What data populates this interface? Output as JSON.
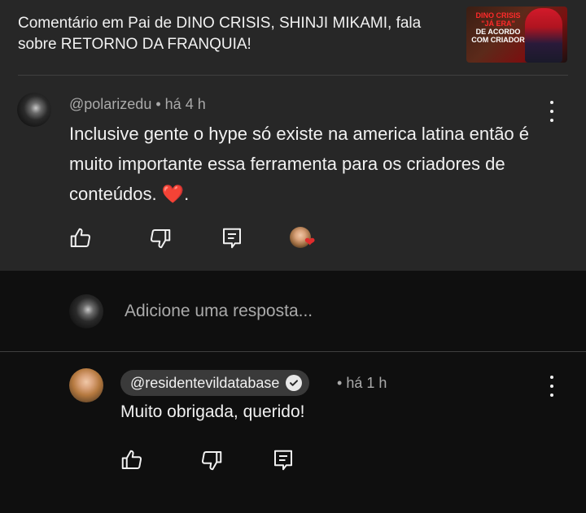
{
  "video": {
    "title": "Comentário em Pai de DINO CRISIS, SHINJI MIKAMI, fala sobre RETORNO DA FRANQUIA!",
    "thumbnail": {
      "line1": "DINO CRISIS",
      "line2": "\"JÁ ERA\"",
      "line3": "DE ACORDO",
      "line4": "COM CRIADOR"
    }
  },
  "comment": {
    "author": "@polarizedu",
    "time": "há 4 h",
    "text": "Inclusive gente o hype só existe na america latina então é muito importante essa ferramenta para os criadores de conteúdos.",
    "emoji": "❤️",
    "trailing": "."
  },
  "actions": {
    "like_icon": "thumb-up-icon",
    "dislike_icon": "thumb-down-icon",
    "reply_icon": "reply-icon",
    "creator_heart_icon": "creator-heart-icon"
  },
  "reply_box": {
    "placeholder": "Adicione uma resposta..."
  },
  "reply": {
    "author": "@residentevildatabase",
    "separator": "•",
    "time": "há 1 h",
    "text": "Muito obrigada, querido!"
  },
  "colors": {
    "header_bg": "#272727",
    "page_bg": "#0f0f0f",
    "heart": "#e02c2c",
    "muted_text": "#aaaaaa"
  }
}
